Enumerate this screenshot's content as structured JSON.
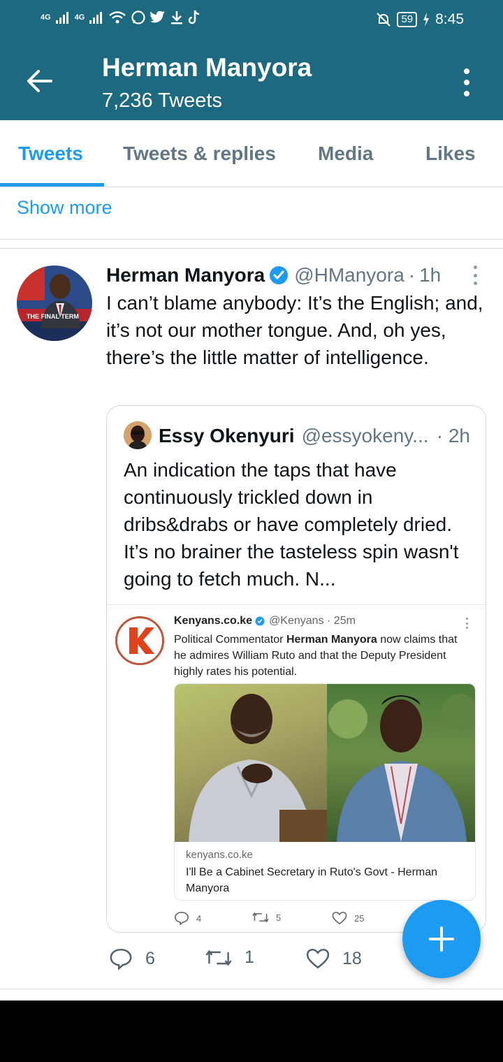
{
  "status_bar": {
    "network_1": "4G",
    "network_2": "4G",
    "battery": "59",
    "time": "8:45"
  },
  "header": {
    "title": "Herman Manyora",
    "subtitle": "7,236 Tweets",
    "bg_color": "#1d6a80"
  },
  "tabs": [
    {
      "label": "Tweets",
      "active": true
    },
    {
      "label": "Tweets & replies",
      "active": false
    },
    {
      "label": "Media",
      "active": false
    },
    {
      "label": "Likes",
      "active": false
    }
  ],
  "show_more": "Show more",
  "tweet": {
    "name": "Herman Manyora",
    "handle": "@HManyora",
    "separator": "·",
    "time": "1h",
    "text": "I can’t blame anybody: It’s the English; and, it’s not our mother tongue. And, oh yes, there’s the little matter of intelligence.",
    "avatar_caption": "THE FINAL TERM",
    "quote": {
      "name": "Essy Okenyuri",
      "handle": "@essyokeny...",
      "separator": "·",
      "time": "2h",
      "text": "An indication the taps that have continuously trickled down in dribs&drabs or have completely dried. It’s no brainer the tasteless spin wasn't going to fetch much. N...",
      "embedded": {
        "name": "Kenyans.co.ke",
        "handle": "@Kenyans · 25m",
        "text_prefix": "Political Commentator ",
        "text_bold": "Herman Manyora",
        "text_suffix": " now claims that he admires William Ruto and that the Deputy President highly rates his potential.",
        "link_domain": "kenyans.co.ke",
        "link_title": "I'll Be a Cabinet Secretary in Ruto's Govt - Herman Manyora",
        "replies": "4",
        "retweets": "5",
        "likes": "25"
      }
    },
    "replies": "6",
    "retweets": "1",
    "likes": "18"
  },
  "colors": {
    "accent": "#1d9bf0",
    "secondary_text": "#627785"
  }
}
